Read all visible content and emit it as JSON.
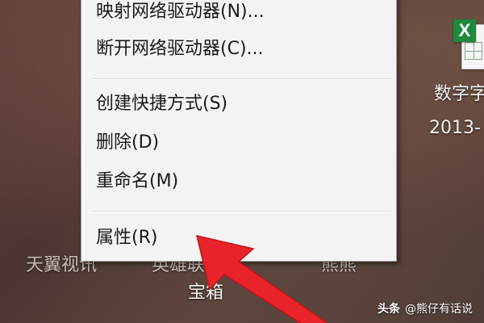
{
  "desktop": {
    "file_label_line1": "数字字",
    "file_label_line2": "2013-",
    "icon_label_left": "天翼视讯",
    "icon_label_mid": "英雄联盟",
    "icon_label_mid_line2": "宝箱",
    "icon_label_right": "熊熊",
    "file_badge": "X"
  },
  "context_menu": {
    "items": [
      {
        "label": "映射网络驱动器(N)..."
      },
      {
        "label": "断开网络驱动器(C)..."
      },
      {
        "label": "创建快捷方式(S)"
      },
      {
        "label": "删除(D)"
      },
      {
        "label": "重命名(M)"
      },
      {
        "label": "属性(R)"
      }
    ]
  },
  "watermark": {
    "brand": "头条",
    "author": "@熊仔有话说"
  },
  "colors": {
    "arrow": "#e8232a",
    "menu_bg": "#f3f3f3",
    "excel_green": "#1f8a3d"
  }
}
